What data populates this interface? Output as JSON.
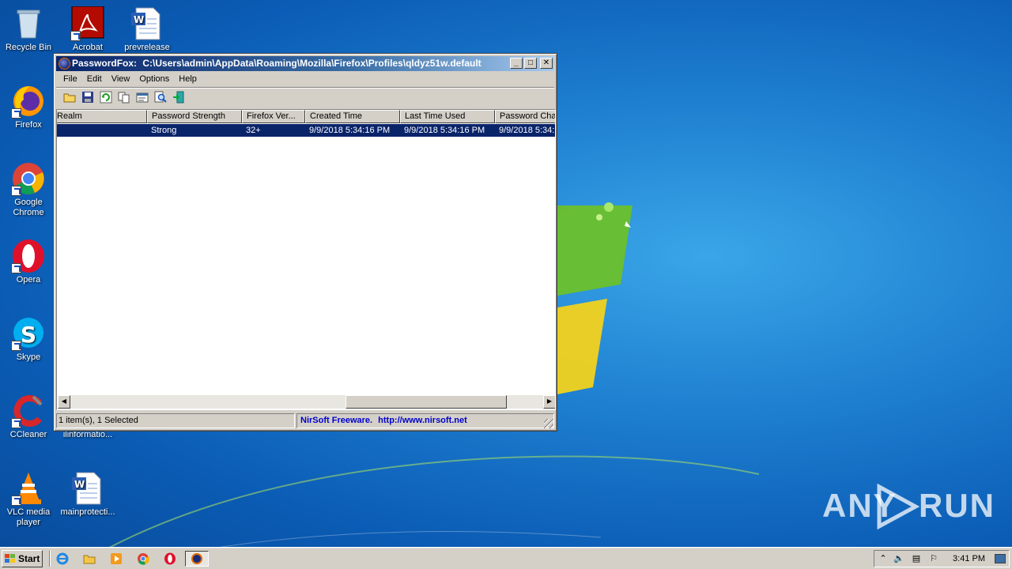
{
  "desktop": {
    "icons": [
      {
        "label": "Recycle Bin",
        "icon": "recycle-bin-icon"
      },
      {
        "label": "Acrobat",
        "icon": "acrobat-icon"
      },
      {
        "label": "prevrelease",
        "icon": "word-document-icon"
      },
      {
        "label": "Firefox",
        "icon": "firefox-icon"
      },
      {
        "label": "Google Chrome",
        "icon": "chrome-icon"
      },
      {
        "label": "Opera",
        "icon": "opera-icon"
      },
      {
        "label": "Skype",
        "icon": "skype-icon"
      },
      {
        "label": "CCleaner",
        "icon": "ccleaner-icon"
      },
      {
        "label": "ilinformatio...",
        "icon": "file-icon"
      },
      {
        "label": "VLC media player",
        "icon": "vlc-icon"
      },
      {
        "label": "mainprotecti...",
        "icon": "word-document-icon"
      }
    ],
    "watermark": {
      "left": "ANY",
      "right": "RUN"
    }
  },
  "window": {
    "app_name": "PasswordFox:",
    "title_path": "C:\\Users\\admin\\AppData\\Roaming\\Mozilla\\Firefox\\Profiles\\qldyz51w.default",
    "controls": {
      "minimize": "_",
      "maximize": "□",
      "close": "✕"
    },
    "menu": [
      "File",
      "Edit",
      "View",
      "Options",
      "Help"
    ],
    "toolbar": [
      "open-folder-icon",
      "save-icon",
      "refresh-icon",
      "copy-icon",
      "properties-icon",
      "find-icon",
      "exit-icon"
    ],
    "columns": [
      "Realm",
      "Password Strength",
      "Firefox Ver...",
      "Created Time",
      "Last Time Used",
      "Password Chan"
    ],
    "rows": [
      {
        "realm": "",
        "strength": "Strong",
        "version": "32+",
        "created": "9/9/2018 5:34:16 PM",
        "last_used": "9/9/2018 5:34:16 PM",
        "changed": "9/9/2018 5:34:"
      }
    ],
    "status": {
      "count": "1 item(s), 1 Selected",
      "freeware": "NirSoft Freeware.",
      "url": "http://www.nirsoft.net"
    },
    "accent": "#0a246a"
  },
  "taskbar": {
    "start_label": "Start",
    "clock": "3:41 PM",
    "pinned": [
      "ie-icon",
      "explorer-icon",
      "media-player-icon",
      "chrome-icon",
      "opera-icon",
      "passwordfox-icon"
    ]
  }
}
